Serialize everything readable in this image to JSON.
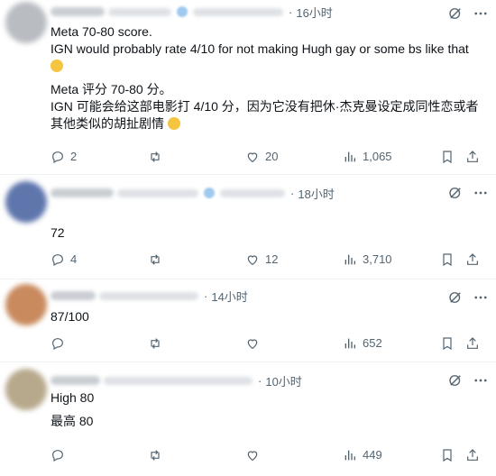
{
  "posts": [
    {
      "time": "16小时",
      "lines": [
        "Meta 70-80 score.",
        "IGN would probably rate 4/10 for not making Hugh gay or some bs like that",
        "",
        "Meta 评分 70-80 分。",
        "IGN 可能会给这部电影打 4/10 分，因为它没有把休·杰克曼设定成同性恋或者",
        "其他类似的胡扯剧情"
      ],
      "replies": "2",
      "reposts": "",
      "likes": "20",
      "views": "1,065"
    },
    {
      "time": "18小时",
      "lines": [
        "72"
      ],
      "replies": "4",
      "reposts": "",
      "likes": "12",
      "views": "3,710"
    },
    {
      "time": "14小时",
      "lines": [
        "87/100"
      ],
      "replies": "",
      "reposts": "",
      "likes": "",
      "views": "652"
    },
    {
      "time": "10小时",
      "lines": [
        "High 80",
        "",
        "最高 80"
      ],
      "replies": "",
      "reposts": "",
      "likes": "",
      "views": "449"
    }
  ],
  "icons": {
    "reply": "reply-icon",
    "repost": "repost-icon",
    "like": "like-icon",
    "views": "views-icon",
    "bookmark": "bookmark-icon",
    "share": "share-icon",
    "grok": "grok-icon",
    "more": "more-icon"
  },
  "colors": {
    "text": "#0f1419",
    "muted": "#536471",
    "divider": "#eff3f4"
  }
}
